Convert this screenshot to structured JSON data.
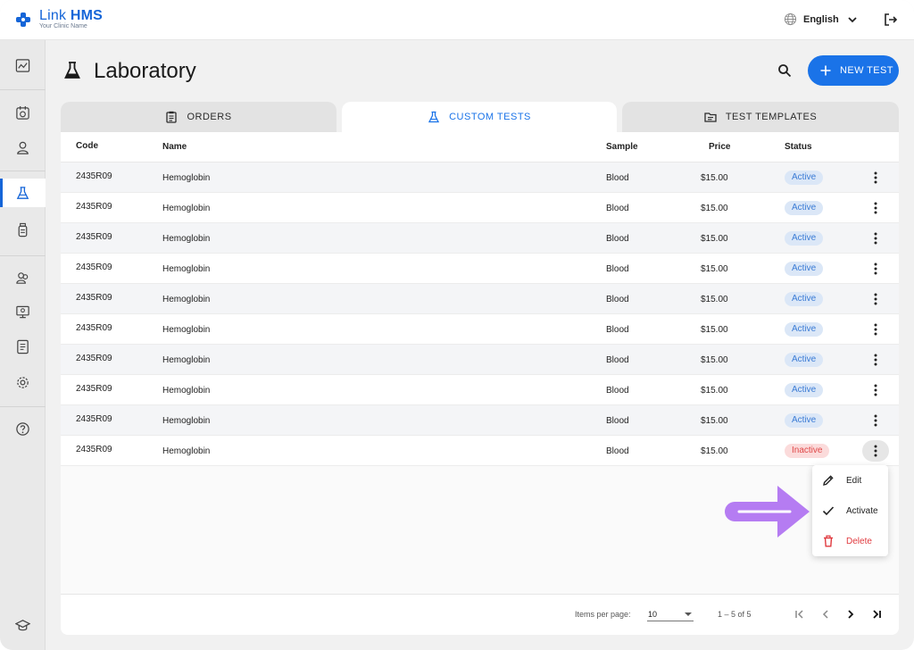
{
  "app": {
    "name_light": "Link",
    "name_bold": "HMS",
    "subtitle": "Your Clinic Name",
    "language": "English",
    "brand_color": "#1565d8"
  },
  "icons": {
    "logo": "medical-cross-icon",
    "language": "globe-icon",
    "logout": "logout-icon",
    "sidebar": [
      "dashboard-icon",
      "calendar-icon",
      "person-icon",
      "flask-icon",
      "bottle-icon",
      "users-icon",
      "monitor-icon",
      "report-icon",
      "gear-icon",
      "help-icon",
      "graduation-cap-icon"
    ]
  },
  "page": {
    "title": "Laboratory",
    "new_test_label": "NEW TEST"
  },
  "tabs": [
    {
      "label": "ORDERS",
      "icon": "clipboard-icon"
    },
    {
      "label": "CUSTOM TESTS",
      "icon": "flask-icon",
      "active": true
    },
    {
      "label": "TEST TEMPLATES",
      "icon": "folder-icon"
    }
  ],
  "table": {
    "columns": [
      "Code",
      "Name",
      "Sample",
      "Price",
      "Status"
    ],
    "rows": [
      {
        "code": "2435R09",
        "name": "Hemoglobin",
        "sample": "Blood",
        "price": "$15.00",
        "status": "Active"
      },
      {
        "code": "2435R09",
        "name": "Hemoglobin",
        "sample": "Blood",
        "price": "$15.00",
        "status": "Active"
      },
      {
        "code": "2435R09",
        "name": "Hemoglobin",
        "sample": "Blood",
        "price": "$15.00",
        "status": "Active"
      },
      {
        "code": "2435R09",
        "name": "Hemoglobin",
        "sample": "Blood",
        "price": "$15.00",
        "status": "Active"
      },
      {
        "code": "2435R09",
        "name": "Hemoglobin",
        "sample": "Blood",
        "price": "$15.00",
        "status": "Active"
      },
      {
        "code": "2435R09",
        "name": "Hemoglobin",
        "sample": "Blood",
        "price": "$15.00",
        "status": "Active"
      },
      {
        "code": "2435R09",
        "name": "Hemoglobin",
        "sample": "Blood",
        "price": "$15.00",
        "status": "Active"
      },
      {
        "code": "2435R09",
        "name": "Hemoglobin",
        "sample": "Blood",
        "price": "$15.00",
        "status": "Active"
      },
      {
        "code": "2435R09",
        "name": "Hemoglobin",
        "sample": "Blood",
        "price": "$15.00",
        "status": "Active"
      },
      {
        "code": "2435R09",
        "name": "Hemoglobin",
        "sample": "Blood",
        "price": "$15.00",
        "status": "Inactive"
      }
    ]
  },
  "row_menu": {
    "items": [
      {
        "label": "Edit",
        "icon": "pencil-icon"
      },
      {
        "label": "Activate",
        "icon": "check-icon"
      },
      {
        "label": "Delete",
        "icon": "trash-icon",
        "danger": true
      }
    ]
  },
  "pagination": {
    "items_per_page_label": "Items per page:",
    "items_per_page": "10",
    "range": "1 – 5 of 5"
  },
  "colors": {
    "primary": "#1a73e8",
    "active_badge_bg": "#dbe7f7",
    "active_badge_text": "#3a7bd5",
    "inactive_badge_bg": "#fbdbdb",
    "inactive_badge_text": "#e04848",
    "annotation_arrow": "#b57cf2"
  }
}
